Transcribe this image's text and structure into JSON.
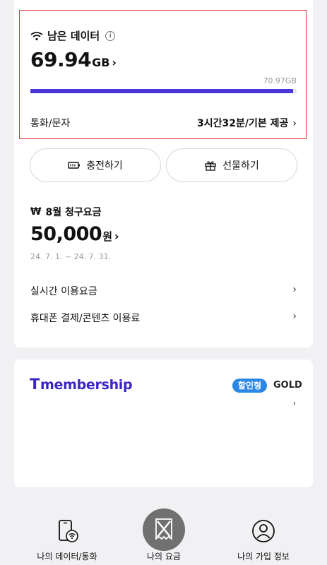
{
  "data_section": {
    "title": "남은 데이터",
    "info_icon": "info-icon",
    "remaining": "69.94",
    "unit": "GB",
    "total": "70.97GB",
    "remaining_fraction": 0.9855,
    "bar_color": "#4a36d8",
    "call_label": "통화/문자",
    "call_value": "3시간32분/기본 제공"
  },
  "actions": {
    "charge": "충전하기",
    "gift": "선물하기"
  },
  "bill": {
    "title": "8월 청구요금",
    "currency_symbol": "₩",
    "amount": "50,000",
    "unit": "원",
    "period": "24. 7. 1. ~ 24. 7. 31.",
    "menu": [
      "실시간 이용요금",
      "휴대폰 결제/콘텐츠 이용료"
    ]
  },
  "membership": {
    "logo_t": "T",
    "logo_text": "membership",
    "badge": "할인형",
    "grade": "GOLD",
    "brand_color": "#3a25c9",
    "badge_color": "#2b87e6"
  },
  "tabbar": {
    "tab1": "나의 데이터/통화",
    "tab2": "나의 요금",
    "tab3": "나의 가입 정보",
    "fab_icon": "close-icon"
  },
  "chevron": "›"
}
